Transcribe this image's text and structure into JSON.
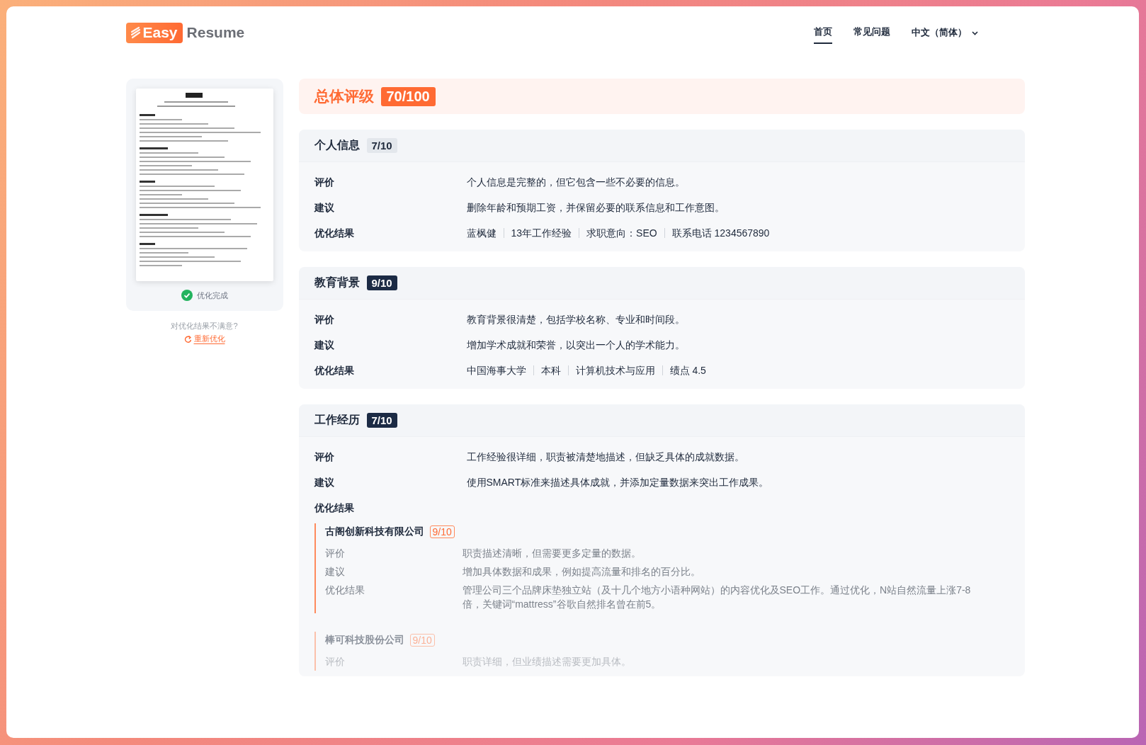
{
  "logo": {
    "badge": "Easy",
    "text": "Resume"
  },
  "nav": [
    {
      "label": "首页",
      "selected": true
    },
    {
      "label": "常见问题",
      "selected": false
    }
  ],
  "language": {
    "label": "中文（简体）"
  },
  "preview": {
    "kind": "picture",
    "status": "优化完成"
  },
  "retry": {
    "prompt": "对优化结果不满意?",
    "action": "重新优化"
  },
  "overall": {
    "title": "总体评级",
    "score": "70/100"
  },
  "sections": [
    {
      "title": "个人信息",
      "score": "7/10",
      "highlighted": false,
      "rows": [
        {
          "kind": "text",
          "label": "评价",
          "text": "个人信息是完整的，但它包含一些不必要的信息。"
        },
        {
          "kind": "text",
          "label": "建议",
          "text": "删除年龄和预期工资，并保留必要的联系信息和工作意图。"
        },
        {
          "kind": "parts",
          "label": "优化结果",
          "parts": [
            "蓝枫健",
            "13年工作经验",
            "求职意向：SEO",
            "联系电话 1234567890"
          ]
        }
      ]
    },
    {
      "title": "教育背景",
      "score": "9/10",
      "highlighted": true,
      "rows": [
        {
          "kind": "text",
          "label": "评价",
          "text": "教育背景很清楚，包括学校名称、专业和时间段。"
        },
        {
          "kind": "text",
          "label": "建议",
          "text": "增加学术成就和荣誉，以突出一个人的学术能力。"
        },
        {
          "kind": "parts",
          "label": "优化结果",
          "parts": [
            "中国海事大学",
            "本科",
            "计算机技术与应用",
            "绩点 4.5"
          ]
        }
      ]
    },
    {
      "title": "工作经历",
      "score": "7/10",
      "highlighted": true,
      "rows": [
        {
          "kind": "text",
          "label": "评价",
          "text": "工作经验很详细，职责被清楚地描述，但缺乏具体的成就数据。"
        },
        {
          "kind": "text",
          "label": "建议",
          "text": "使用SMART标准来描述具体成就，并添加定量数据来突出工作成果。"
        },
        {
          "kind": "jobs",
          "label": "优化结果",
          "jobs": [
            {
              "company": "古阁创新科技有限公司",
              "score": "9/10",
              "faded": false,
              "rows": [
                {
                  "label": "评价",
                  "text": "职责描述清晰，但需要更多定量的数据。"
                },
                {
                  "label": "建议",
                  "text": "增加具体数据和成果，例如提高流量和排名的百分比。"
                },
                {
                  "label": "优化结果",
                  "text": "管理公司三个品牌床垫独立站（及十几个地方小语种网站）的内容优化及SEO工作。通过优化，N站自然流量上涨7-8倍，关键词“mattress”谷歌自然排名曾在前5。"
                }
              ]
            },
            {
              "company": "棒可科技股份公司",
              "score": "9/10",
              "faded": true,
              "rows": [
                {
                  "label": "评价",
                  "text": "职责详细，但业绩描述需要更加具体。"
                }
              ]
            }
          ]
        }
      ]
    }
  ]
}
